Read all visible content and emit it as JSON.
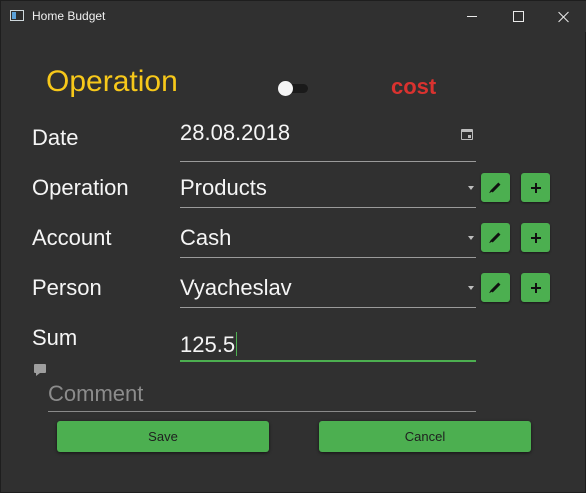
{
  "window": {
    "title": "Home Budget"
  },
  "header": {
    "heading": "Operation",
    "mode": "cost",
    "mode_color": "#d9322f",
    "heading_color": "#f7c81a"
  },
  "form": {
    "date": {
      "label": "Date",
      "value": "28.08.2018",
      "icon": "calendar-icon"
    },
    "operation": {
      "label": "Operation",
      "value": "Products"
    },
    "account": {
      "label": "Account",
      "value": "Cash"
    },
    "person": {
      "label": "Person",
      "value": "Vyacheslav"
    },
    "sum": {
      "label": "Sum",
      "value": "125.5"
    },
    "comment": {
      "placeholder": "Comment",
      "icon": "comment-icon"
    }
  },
  "actions": {
    "save_label": "Save",
    "cancel_label": "Cancel"
  },
  "colors": {
    "accent": "#4caf50",
    "background": "#303030"
  }
}
